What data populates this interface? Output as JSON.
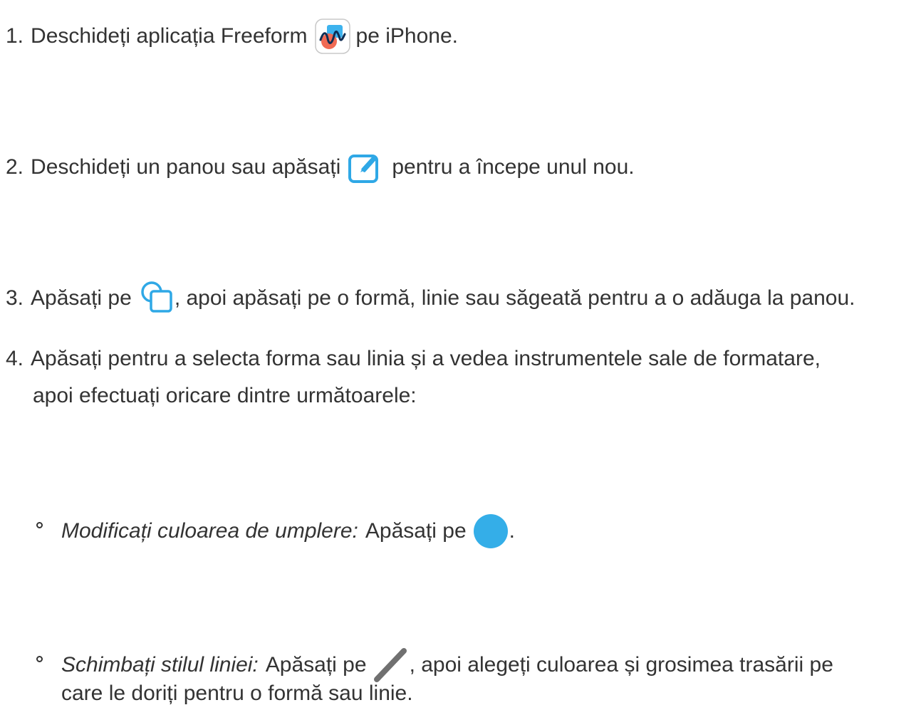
{
  "steps": [
    {
      "number": "1.",
      "text_before": "Deschideți aplicația Freeform",
      "icon": "freeform-app-icon",
      "text_after": "pe iPhone."
    },
    {
      "number": "2.",
      "text_before": "Deschideți un panou sau apăsați",
      "icon": "compose-icon",
      "text_after": "pentru a începe unul nou."
    },
    {
      "number": "3.",
      "text_before": "Apăsați pe",
      "icon": "shapes-icon",
      "text_after": ", apoi apăsați pe o formă, linie sau săgeată pentru a o adăuga la panou."
    },
    {
      "number": "4.",
      "text_line1": "Apăsați pentru a selecta forma sau linia și a vedea instrumentele sale de formatare,",
      "text_line2": "apoi efectuați oricare dintre următoarele:"
    }
  ],
  "sub_items": [
    {
      "label": "Modificați culoarea de umplere:",
      "text_before": "Apăsați pe",
      "icon": "fill-color-icon",
      "text_after": "."
    },
    {
      "label": "Schimbați stilul liniei:",
      "text_before": "Apăsați pe",
      "icon": "line-style-icon",
      "text_after": ", apoi alegeți culoarea și grosimea trasării pe",
      "text_line2": "care le doriți pentru o formă sau linie."
    }
  ],
  "colors": {
    "text": "#333333",
    "accent_blue": "#2fa8e6",
    "line_gray": "#707070"
  }
}
